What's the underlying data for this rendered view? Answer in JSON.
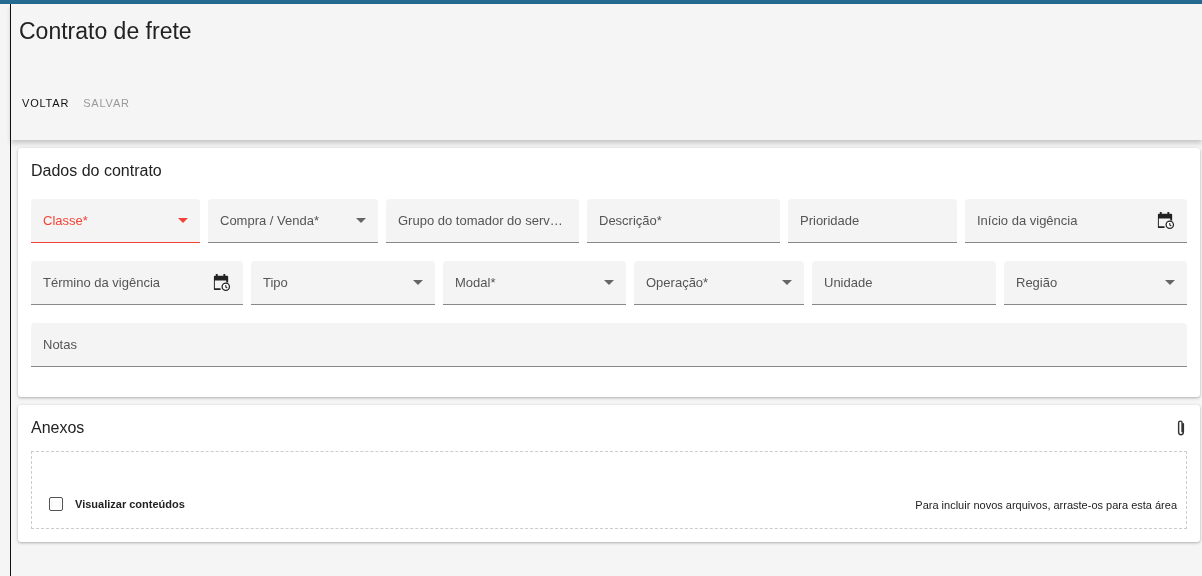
{
  "page": {
    "title": "Contrato de frete"
  },
  "actions": [
    {
      "label": "VOLTAR",
      "disabled": false
    },
    {
      "label": "SALVAR",
      "disabled": true
    }
  ],
  "contract": {
    "title": "Dados do contrato",
    "rows": [
      [
        {
          "label": "Classe*",
          "kind": "select",
          "error": true
        },
        {
          "label": "Compra / Venda*",
          "kind": "select",
          "error": false
        },
        {
          "label": "Grupo do tomador do serv…",
          "kind": "text",
          "error": false
        },
        {
          "label": "Descrição*",
          "kind": "text",
          "error": false
        },
        {
          "label": "Prioridade",
          "kind": "text",
          "error": false
        },
        {
          "label": "Início da vigência",
          "kind": "date",
          "error": false
        }
      ],
      [
        {
          "label": "Término da vigência",
          "kind": "date",
          "error": false
        },
        {
          "label": "Tipo",
          "kind": "select",
          "error": false
        },
        {
          "label": "Modal*",
          "kind": "select",
          "error": false
        },
        {
          "label": "Operação*",
          "kind": "select",
          "error": false
        },
        {
          "label": "Unidade",
          "kind": "text",
          "error": false
        },
        {
          "label": "Região",
          "kind": "select",
          "error": false
        }
      ],
      [
        {
          "label": "Notas",
          "kind": "text",
          "error": false
        }
      ]
    ]
  },
  "attachments": {
    "title": "Anexos",
    "view_contents": {
      "label": "Visualizar conteúdos",
      "checked": false
    },
    "drop_hint": "Para incluir novos arquivos, arraste-os para esta área"
  }
}
